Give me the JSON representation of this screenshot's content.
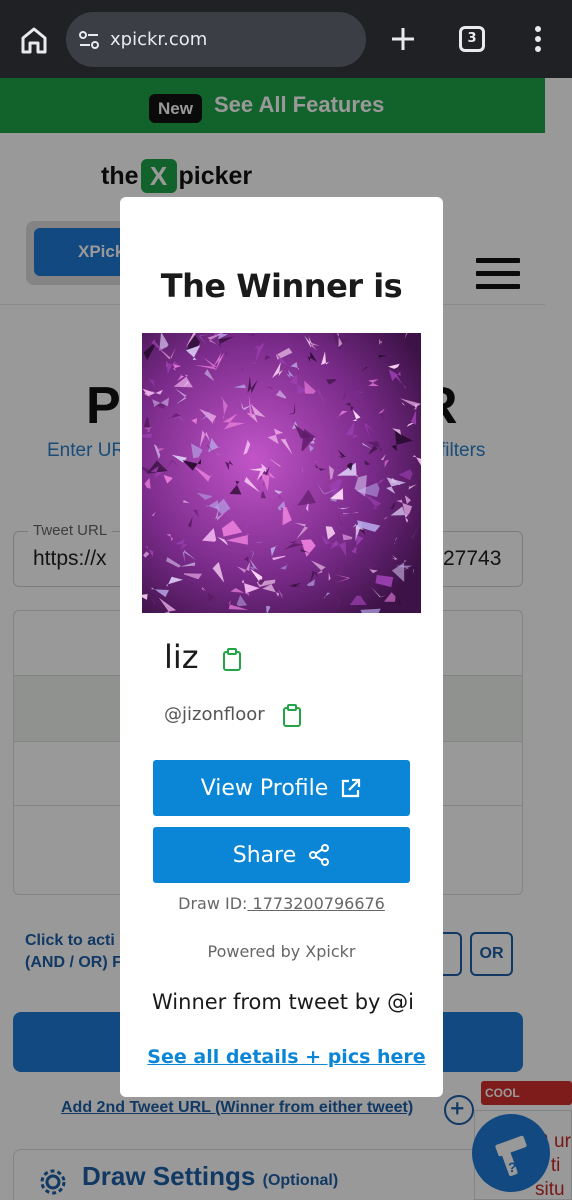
{
  "browser": {
    "url": "xpickr.com",
    "tab_count": "3"
  },
  "banner": {
    "badge": "New",
    "link": "See All Features"
  },
  "header": {
    "logo_left": "the",
    "logo_mark": "X",
    "logo_right": "picker",
    "nav_button": "XPick"
  },
  "hero": {
    "title_left": "P",
    "title_right": "R",
    "subtitle_left": "Enter UR",
    "subtitle_right": "filters"
  },
  "tweet_input": {
    "label": "Tweet URL",
    "value_left": "https://x",
    "value_right": "27743"
  },
  "filters": {
    "hint": "Click to acti",
    "hint_line2": "(AND / OR) F",
    "or_label": "OR"
  },
  "add_tweet": {
    "label": "Add 2nd Tweet URL (Winner from either tweet)"
  },
  "settings": {
    "title": "Draw Settings",
    "optional": "(Optional)"
  },
  "promo": {
    "badge": "COOL FEATURE",
    "line1": "R ur",
    "line2": "n ti",
    "line3": "situ"
  },
  "modal": {
    "title": "The Winner is",
    "name": "liz",
    "handle": "@jizonfloor",
    "view_profile": "View Profile",
    "share": "Share",
    "draw_id_label": "Draw ID:",
    "draw_id_value": " 1773200796676",
    "powered_by": "Powered by Xpickr",
    "from_tweet": "Winner from tweet by @i",
    "details_link": "See all details + pics here"
  },
  "colors": {
    "banner_green": "#1fa34a",
    "primary_blue": "#0b86d6",
    "link_blue": "#1d5fa6",
    "copy_green": "#22a447"
  }
}
